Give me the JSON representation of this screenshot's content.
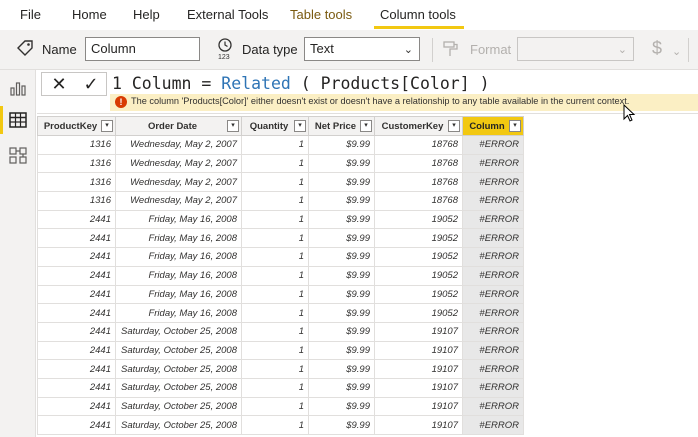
{
  "ribbon_tabs": [
    "File",
    "Home",
    "Help",
    "External Tools",
    "Table tools",
    "Column tools"
  ],
  "ribbon": {
    "name_label": "Name",
    "name_value": "Column",
    "datatype_label": "Data type",
    "datatype_value": "Text",
    "format_label": "Format",
    "format_value": "",
    "currency_symbol": "$"
  },
  "formula_bar": {
    "cancel_glyph": "✕",
    "commit_glyph": "✓",
    "line_number": "1",
    "pre_text": " Column = ",
    "function_name": "Related",
    "post_text": " ( Products[Color] )",
    "error_icon": "!",
    "error_message": "The column 'Products[Color]' either doesn't exist or doesn't have a relationship to any table available in the current context."
  },
  "table": {
    "columns": [
      "ProductKey",
      "Order Date",
      "Quantity",
      "Net Price",
      "CustomerKey",
      "Column"
    ],
    "rows": [
      [
        "1316",
        "Wednesday, May 2, 2007",
        "1",
        "$9.99",
        "18768",
        "#ERROR"
      ],
      [
        "1316",
        "Wednesday, May 2, 2007",
        "1",
        "$9.99",
        "18768",
        "#ERROR"
      ],
      [
        "1316",
        "Wednesday, May 2, 2007",
        "1",
        "$9.99",
        "18768",
        "#ERROR"
      ],
      [
        "1316",
        "Wednesday, May 2, 2007",
        "1",
        "$9.99",
        "18768",
        "#ERROR"
      ],
      [
        "2441",
        "Friday, May 16, 2008",
        "1",
        "$9.99",
        "19052",
        "#ERROR"
      ],
      [
        "2441",
        "Friday, May 16, 2008",
        "1",
        "$9.99",
        "19052",
        "#ERROR"
      ],
      [
        "2441",
        "Friday, May 16, 2008",
        "1",
        "$9.99",
        "19052",
        "#ERROR"
      ],
      [
        "2441",
        "Friday, May 16, 2008",
        "1",
        "$9.99",
        "19052",
        "#ERROR"
      ],
      [
        "2441",
        "Friday, May 16, 2008",
        "1",
        "$9.99",
        "19052",
        "#ERROR"
      ],
      [
        "2441",
        "Friday, May 16, 2008",
        "1",
        "$9.99",
        "19052",
        "#ERROR"
      ],
      [
        "2441",
        "Saturday, October 25, 2008",
        "1",
        "$9.99",
        "19107",
        "#ERROR"
      ],
      [
        "2441",
        "Saturday, October 25, 2008",
        "1",
        "$9.99",
        "19107",
        "#ERROR"
      ],
      [
        "2441",
        "Saturday, October 25, 2008",
        "1",
        "$9.99",
        "19107",
        "#ERROR"
      ],
      [
        "2441",
        "Saturday, October 25, 2008",
        "1",
        "$9.99",
        "19107",
        "#ERROR"
      ],
      [
        "2441",
        "Saturday, October 25, 2008",
        "1",
        "$9.99",
        "19107",
        "#ERROR"
      ],
      [
        "2441",
        "Saturday, October 25, 2008",
        "1",
        "$9.99",
        "19107",
        "#ERROR"
      ]
    ],
    "selected_column": "Column"
  },
  "icons": {
    "name": "tag-icon",
    "datatype": "datatype-123-icon",
    "format": "format-painter-icon",
    "views": [
      "report-view-icon",
      "table-view-icon",
      "model-view-icon"
    ]
  },
  "colors": {
    "accent": "#f2c811",
    "error_banner": "#fbefc4",
    "error_icon": "#d83b01",
    "function_keyword": "#2e74b5"
  }
}
